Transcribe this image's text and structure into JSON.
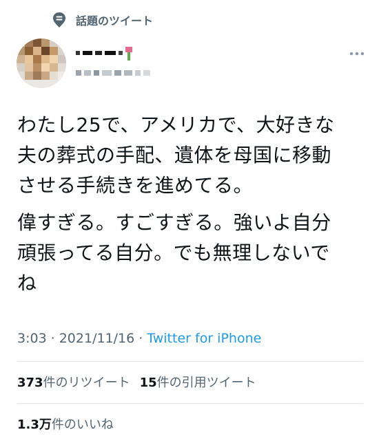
{
  "topic": {
    "label": "話題のツイート",
    "icon": "topic-bubble-icon"
  },
  "author": {
    "avatar_icon": "pixelated-avatar",
    "name_obscured": true,
    "handle_obscured": true,
    "badge_icon": "flower-emoji-icon"
  },
  "more_icon": "more-dots-icon",
  "tweet": {
    "paragraphs": [
      "わたし25で、アメリカで、大好きな\n夫の葬式の手配、遺体を母国に移動\nさせる手続きを進めてる。",
      "偉すぎる。すごすぎる。強いよ自分\n頑張ってる自分。でも無理しないで\nね"
    ]
  },
  "meta": {
    "time": "3:03",
    "separator": "·",
    "date": "2021/11/16",
    "source": "Twitter for iPhone"
  },
  "stats": {
    "retweets_count": "373",
    "retweets_label": "件のリツイート",
    "quotes_count": "15",
    "quotes_label": "件の引用ツイート",
    "likes_count": "1.3万",
    "likes_label": "件のいいね"
  },
  "colors": {
    "text": "#0f1419",
    "secondary": "#536471",
    "link": "#1d9bf0",
    "divider": "#e6e9ea"
  }
}
